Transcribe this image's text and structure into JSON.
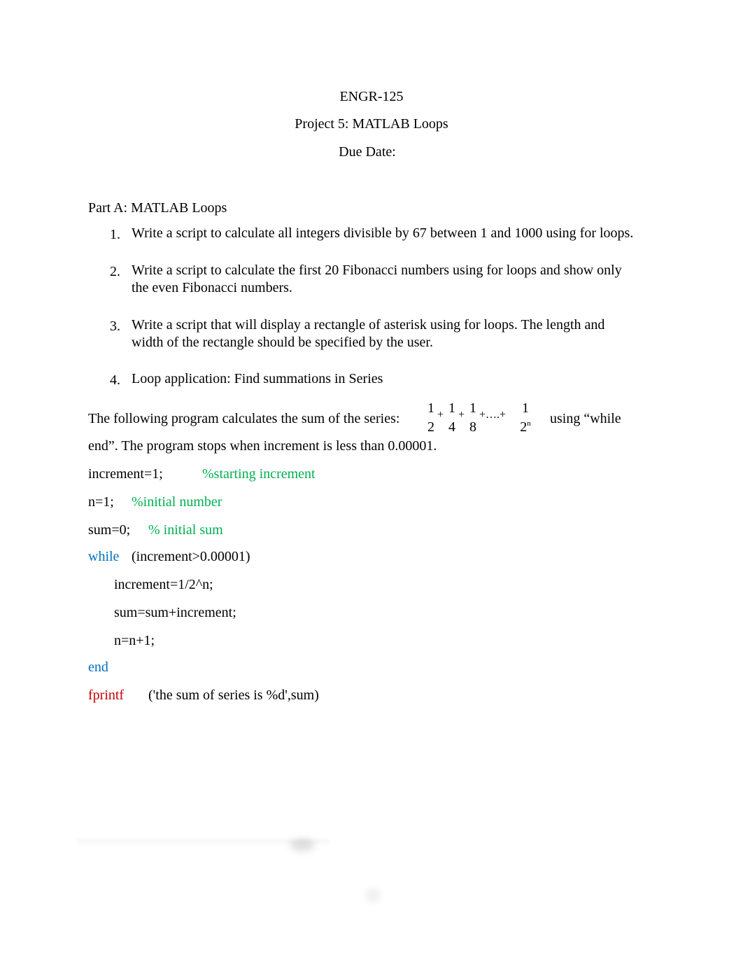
{
  "header": {
    "course": "ENGR-125",
    "project_title": "Project 5: MATLAB Loops",
    "due_date_label": "Due Date:"
  },
  "part_a": {
    "heading": "Part A: MATLAB Loops",
    "items": [
      {
        "number": "1.",
        "lines": [
          "Write a script to calculate all integers divisible by 67 between 1 and 1000 using for loops."
        ]
      },
      {
        "number": "2.",
        "lines": [
          "Write a script to calculate the first 20 Fibonacci numbers using for loops and show only",
          "the even Fibonacci numbers."
        ]
      },
      {
        "number": "3.",
        "lines": [
          "Write a script that will display a rectangle of asterisk using for loops. The length and",
          "width of the rectangle should be specified by the user."
        ]
      },
      {
        "number": "4.",
        "lines": [
          "Loop application: Find summations in Series"
        ]
      }
    ]
  },
  "series_paragraph": {
    "intro": "The following program calculates the sum of the series:",
    "formula": {
      "terms": [
        {
          "numerator": "1",
          "denominator": "2"
        },
        {
          "numerator": "1",
          "denominator": "4"
        },
        {
          "numerator": "1",
          "denominator": "8"
        },
        {
          "numerator": "1",
          "denominator_base": "2",
          "denominator_exp": "n"
        }
      ],
      "plus": "+",
      "ellipsis": "+….+"
    },
    "after_formula": "using “while",
    "line2": "end”. The program stops when increment is less than 0.00001."
  },
  "code": {
    "colors": {
      "comment": "#00B050",
      "keyword": "#0070C0",
      "function": "#C00000"
    },
    "lines": [
      {
        "code": "increment=1;",
        "comment": "%starting increment"
      },
      {
        "code": "n=1;",
        "comment": "%initial number"
      },
      {
        "code": "sum=0;",
        "comment": "% initial sum"
      },
      {
        "keyword": "while",
        "code": "(increment>0.00001)"
      },
      {
        "code": "increment=1/2^n;"
      },
      {
        "code": "sum=sum+increment;"
      },
      {
        "code": "n=n+1;"
      },
      {
        "keyword": "end"
      },
      {
        "function": "fprintf",
        "code": "('the sum of series is %d',sum)"
      }
    ]
  }
}
